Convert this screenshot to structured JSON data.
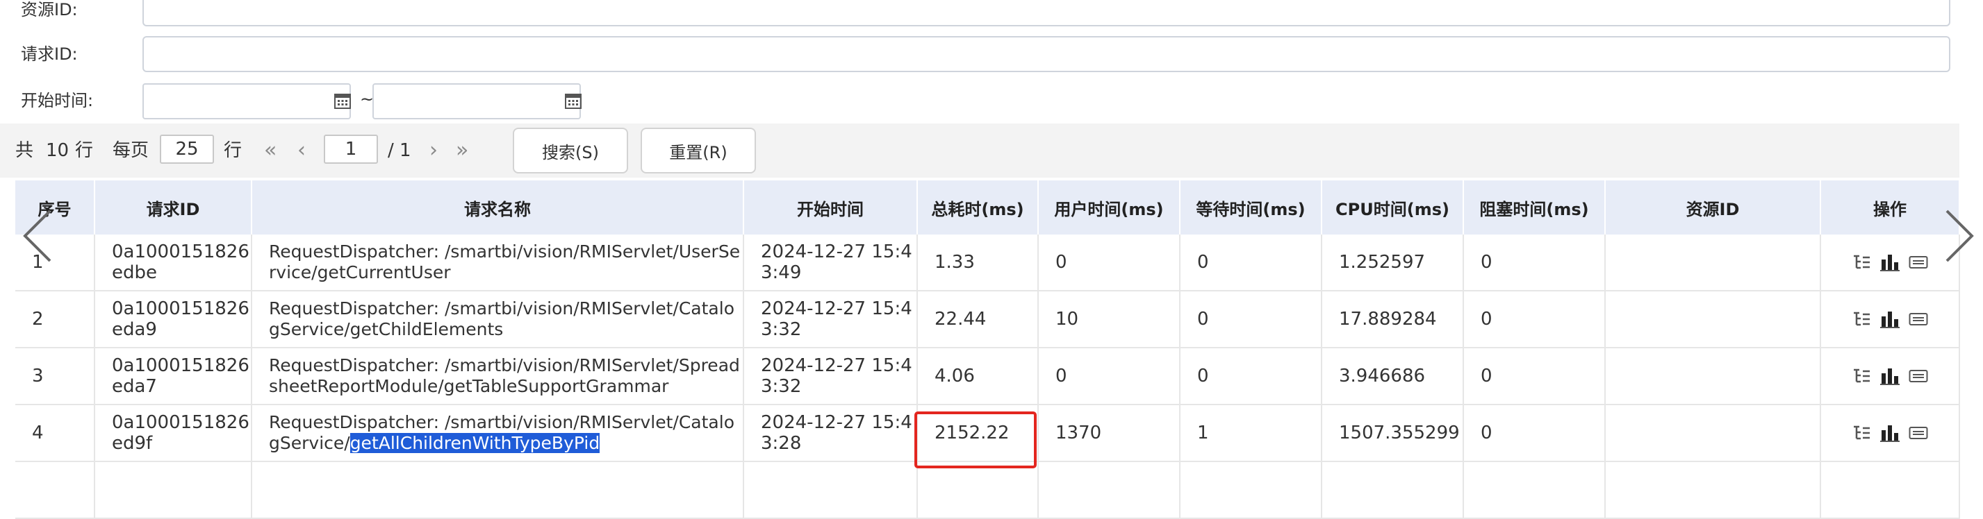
{
  "form": {
    "resource_id_label": "资源ID:",
    "request_id_label": "请求ID:",
    "start_time_label": "开始时间:",
    "range_separator": "~"
  },
  "pager": {
    "total_prefix": "共",
    "total_rows": "10",
    "row_unit": "行",
    "per_page_label": "每页",
    "per_page_value": "25",
    "per_page_unit": "行",
    "first_glyph": "«",
    "prev_glyph": "‹",
    "current_page": "1",
    "total_pages": "/ 1",
    "next_glyph": "›",
    "last_glyph": "»",
    "search_label": "搜索(S)",
    "reset_label": "重置(R)"
  },
  "table": {
    "columns": [
      "序号",
      "请求ID",
      "请求名称",
      "开始时间",
      "总耗时(ms)",
      "用户时间(ms)",
      "等待时间(ms)",
      "CPU时间(ms)",
      "阻塞时间(ms)",
      "资源ID",
      "操作"
    ],
    "rows": [
      {
        "index": "1",
        "request_id": "0a1000151826edbe",
        "name": "RequestDispatcher: /smartbi/vision/RMIServlet/UserService/getCurrentUser",
        "start_time": "2024-12-27 15:43:49",
        "total": "1.33",
        "user": "0",
        "wait": "0",
        "cpu": "1.252597",
        "blocked": "0",
        "resource_id": ""
      },
      {
        "index": "2",
        "request_id": "0a1000151826eda9",
        "name": "RequestDispatcher: /smartbi/vision/RMIServlet/CatalogService/getChildElements",
        "start_time": "2024-12-27 15:43:32",
        "total": "22.44",
        "user": "10",
        "wait": "0",
        "cpu": "17.889284",
        "blocked": "0",
        "resource_id": ""
      },
      {
        "index": "3",
        "request_id": "0a1000151826eda7",
        "name": "RequestDispatcher: /smartbi/vision/RMIServlet/SpreadsheetReportModule/getTableSupportGrammar",
        "start_time": "2024-12-27 15:43:32",
        "total": "4.06",
        "user": "0",
        "wait": "0",
        "cpu": "3.946686",
        "blocked": "0",
        "resource_id": ""
      },
      {
        "index": "4",
        "request_id": "0a1000151826ed9f",
        "name_prefix": "RequestDispatcher: /smartbi/vision/RMIServlet/CatalogService/",
        "name_highlight": "getAllChildrenWithTypeByPid",
        "start_time": "2024-12-27 15:43:28",
        "total": "2152.22",
        "user": "1370",
        "wait": "1",
        "cpu": "1507.355299",
        "blocked": "0",
        "resource_id": ""
      }
    ]
  },
  "icons": [
    "tree-icon",
    "bar-chart-icon",
    "sql-icon",
    "left-arrow-icon",
    "right-arrow-icon",
    "calendar-icon"
  ],
  "colors": {
    "header_bg": "#e7ecf7",
    "highlight": "#1f5cd8",
    "alert_box": "#e3261f",
    "chart_icon": "#222222"
  }
}
